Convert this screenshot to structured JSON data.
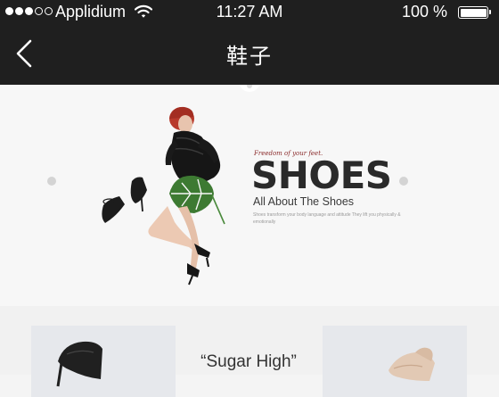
{
  "status": {
    "carrier": "Applidium",
    "time": "11:27 AM",
    "battery": "100 %",
    "battery_level": 1.0,
    "signal": {
      "filled": 3,
      "total": 5
    }
  },
  "nav": {
    "title": "鞋子",
    "back_icon": "chevron-left-icon"
  },
  "banner": {
    "tagline": "Freedom of your feet.",
    "headline": "SHOES",
    "subheadline": "All About The Shoes",
    "body": "Shoes transform your body language and attitude They lift you physically & emotionally"
  },
  "products": [
    {
      "name": ""
    },
    {
      "name": "“Sugar High”"
    },
    {
      "name": ""
    }
  ],
  "colors": {
    "nav_background": "#1f1f1f",
    "tagline": "#8a2b2b",
    "headline": "#2a2a2a",
    "page_background": "#f4f4f4"
  }
}
